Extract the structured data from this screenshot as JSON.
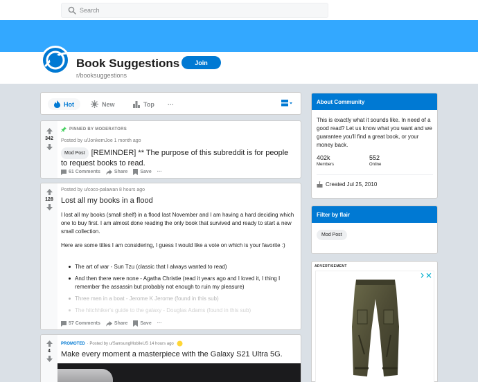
{
  "search": {
    "placeholder": "Search"
  },
  "subreddit": {
    "title": "Book Suggestions",
    "name": "r/booksuggestions",
    "join_label": "Join"
  },
  "sort": {
    "hot": "Hot",
    "new": "New",
    "top": "Top",
    "more": "···"
  },
  "posts": [
    {
      "pinned_label": "PINNED BY MODERATORS",
      "votes": "342",
      "meta": "Posted by u/JonkemJoe 1 month ago",
      "flair": "Mod Post",
      "title": "[REMINDER] ** The purpose of this subreddit is for people to request books to read.",
      "comments": "61 Comments",
      "share": "Share",
      "save": "Save",
      "more": "···"
    },
    {
      "votes": "128",
      "meta": "Posted by u/coco-palawan 8 hours ago",
      "title": "Lost all my books in a flood",
      "body_p1": "I lost all my books (small shelf) in a flood last November and I am having a hard deciding which one to buy first. I am almost done reading the only book that survived and ready to start a new small collection.",
      "body_p2": "Here are some titles I am considering, I guess I would like a vote on which is your favorite :)",
      "bullets": [
        "The art of war - Sun Tzu (classic that I always wanted to read)",
        "And then there were none - Agatha Christie (read it years ago and I loved it, I thing I remember the assassin but probably not enough to ruin my pleasure)",
        "Three men in a boat - Jerome K Jerome (found in this sub)",
        "The hitchhiker's guide to the galaxy - Douglas Adams (found in this sub)"
      ],
      "comments": "57 Comments",
      "share": "Share",
      "save": "Save",
      "more": "···"
    },
    {
      "promoted_label": "PROMOTED",
      "votes": "4",
      "meta": "· Posted by u/SamsungMobileUS 14 hours ago",
      "title": "Make every moment a masterpiece with the Galaxy S21 Ultra 5G."
    }
  ],
  "about": {
    "heading": "About Community",
    "description": "This is exactly what it sounds like. In need of a good read? Let us know what you want and we guarantee you'll find a great book, or your money back.",
    "members_value": "402k",
    "members_label": "Members",
    "online_value": "552",
    "online_label": "Online",
    "created": "Created Jul 25, 2010"
  },
  "flair_filter": {
    "heading": "Filter by flair",
    "chip": "Mod Post"
  },
  "ad": {
    "label": "ADVERTISEMENT"
  },
  "colors": {
    "brand_blue": "#0079d3",
    "banner": "#33a8ff",
    "background": "#dae0e6",
    "upvote": "#878a8c"
  }
}
